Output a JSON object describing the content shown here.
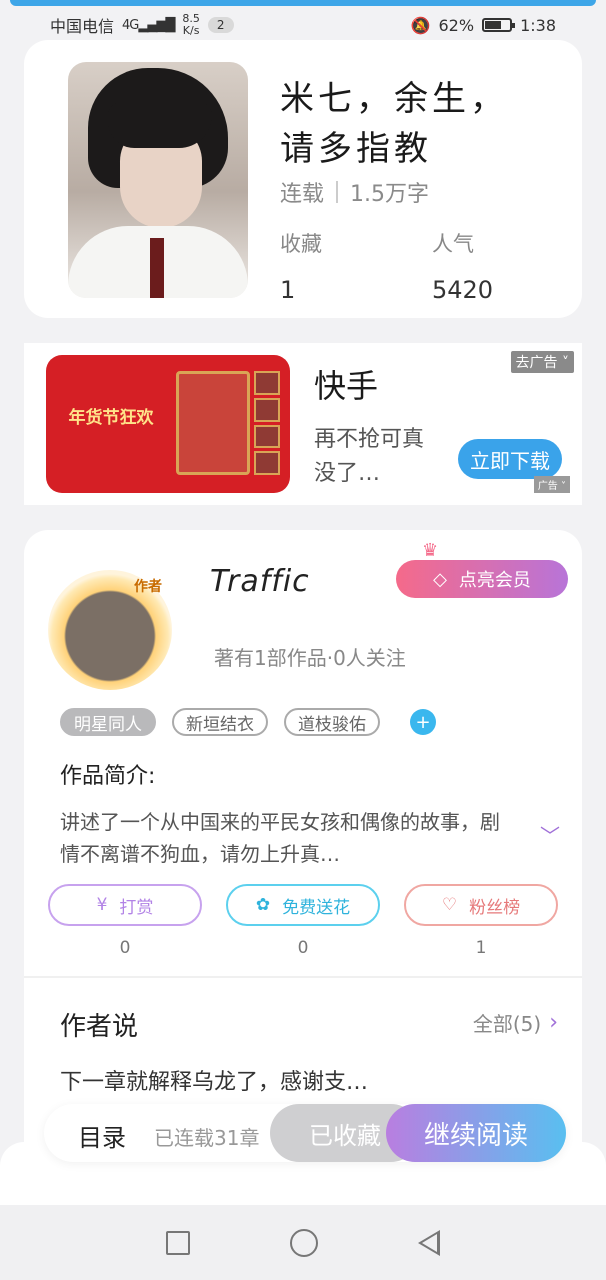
{
  "status_bar": {
    "carrier": "中国电信",
    "network": "4G",
    "speed_value": "8.5",
    "speed_unit": "K/s",
    "notification_count": "2",
    "battery": "62%",
    "time": "1:38"
  },
  "book": {
    "title": "米七，余生，请多指教",
    "status": "连载",
    "word_count": "1.5万字",
    "favorites_label": "收藏",
    "favorites_value": "1",
    "popularity_label": "人气",
    "popularity_value": "5420"
  },
  "ad": {
    "banner_text": "年货节狂欢",
    "title": "快手",
    "description": "再不抢可真没了…",
    "close_label": "去广告",
    "cta_label": "立即下载",
    "tag_label": "广告"
  },
  "author": {
    "avatar_tag": "作者",
    "name": "Traffic",
    "info": "著有1部作品·0人关注",
    "vip_label": "点亮会员",
    "tags": [
      "明星同人",
      "新垣结衣",
      "道枝骏佑"
    ],
    "intro_title": "作品简介:",
    "intro_text": "讲述了一个从中国来的平民女孩和偶像的故事，剧情不离谱不狗血，请勿上升真…",
    "actions": [
      {
        "label": "打赏",
        "count": "0"
      },
      {
        "label": "免费送花",
        "count": "0"
      },
      {
        "label": "粉丝榜",
        "count": "1"
      }
    ]
  },
  "author_says": {
    "title": "作者说",
    "all_label": "全部(5)",
    "text": "下一章就解释乌龙了，感谢支…"
  },
  "bottom_bar": {
    "toc_label": "目录",
    "chapters": "已连载31章",
    "favorited_label": "已收藏",
    "continue_label": "继续阅读"
  },
  "colors": {
    "accent_blue": "#3ea6e8",
    "vip_gradient_start": "#f56a8a",
    "vip_gradient_end": "#b874d8",
    "read_gradient_start": "#b97ee0",
    "read_gradient_end": "#59bff0"
  }
}
